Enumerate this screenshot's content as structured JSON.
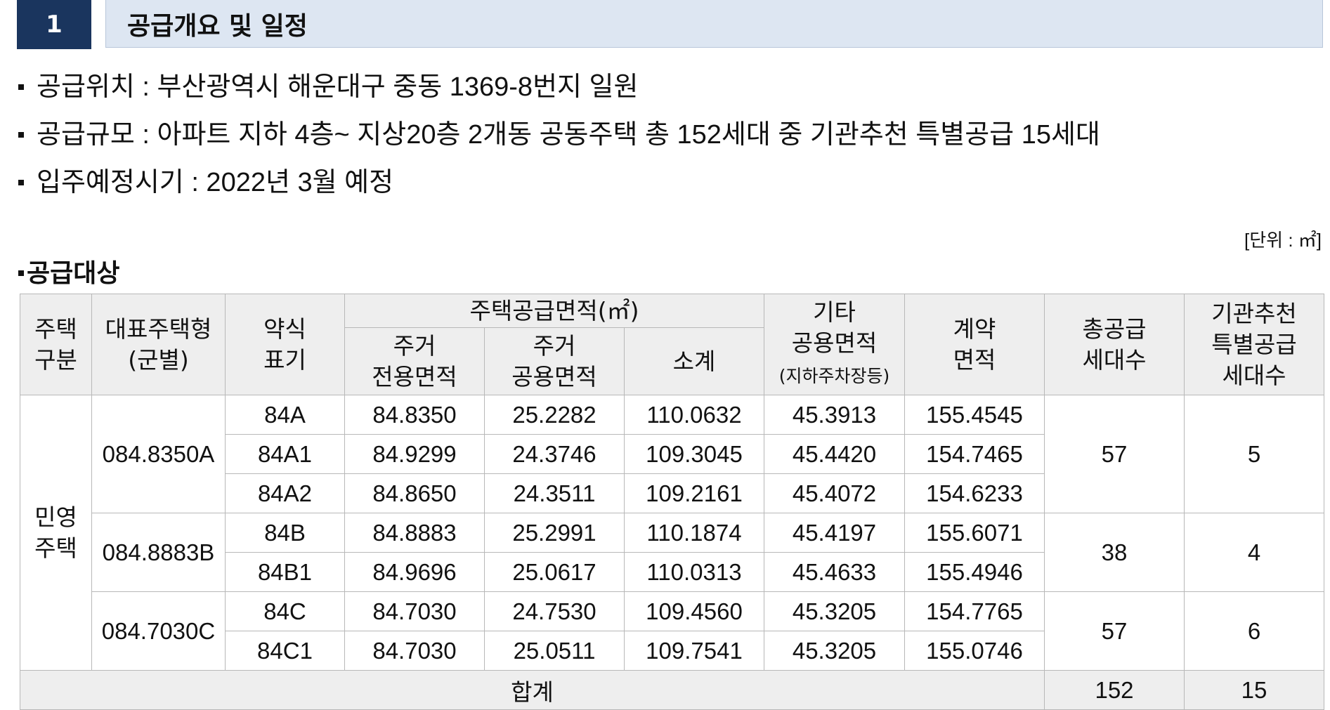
{
  "header": {
    "number": "1",
    "title": "공급개요 및 일정"
  },
  "bullets": [
    "공급위치 : 부산광역시 해운대구 중동 1369-8번지 일원",
    "공급규모 : 아파트 지하 4층~ 지상20층 2개동 공동주택 총 152세대 중 기관추천 특별공급 15세대",
    "입주예정시기 : 2022년 3월 예정"
  ],
  "unit_label": "[단위 : ㎡]",
  "section_title": "공급대상",
  "table": {
    "headers": {
      "house_type_1": "주택",
      "house_type_2": "구분",
      "rep_type_1": "대표주택형",
      "rep_type_2": "(군별)",
      "abbr_1": "약식",
      "abbr_2": "표기",
      "supply_area": "주택공급면적(㎡)",
      "res_exclusive_1": "주거",
      "res_exclusive_2": "전용면적",
      "res_common_1": "주거",
      "res_common_2": "공용면적",
      "subtotal": "소계",
      "other_common_1": "기타",
      "other_common_2": "공용면적",
      "other_common_3": "(지하주차장등)",
      "contract_1": "계약",
      "contract_2": "면적",
      "total_supply_1": "총공급",
      "total_supply_2": "세대수",
      "inst_1": "기관추천",
      "inst_2": "특별공급",
      "inst_3": "세대수"
    },
    "category_1": "민영",
    "category_2": "주택",
    "groups": [
      {
        "rep_type": "084.8350A",
        "total_supply": "57",
        "institutional": "5",
        "rows": [
          {
            "abbr": "84A",
            "exclusive": "84.8350",
            "common": "25.2282",
            "subtotal": "110.0632",
            "other": "45.3913",
            "contract": "155.4545"
          },
          {
            "abbr": "84A1",
            "exclusive": "84.9299",
            "common": "24.3746",
            "subtotal": "109.3045",
            "other": "45.4420",
            "contract": "154.7465"
          },
          {
            "abbr": "84A2",
            "exclusive": "84.8650",
            "common": "24.3511",
            "subtotal": "109.2161",
            "other": "45.4072",
            "contract": "154.6233"
          }
        ]
      },
      {
        "rep_type": "084.8883B",
        "total_supply": "38",
        "institutional": "4",
        "rows": [
          {
            "abbr": "84B",
            "exclusive": "84.8883",
            "common": "25.2991",
            "subtotal": "110.1874",
            "other": "45.4197",
            "contract": "155.6071"
          },
          {
            "abbr": "84B1",
            "exclusive": "84.9696",
            "common": "25.0617",
            "subtotal": "110.0313",
            "other": "45.4633",
            "contract": "155.4946"
          }
        ]
      },
      {
        "rep_type": "084.7030C",
        "total_supply": "57",
        "institutional": "6",
        "rows": [
          {
            "abbr": "84C",
            "exclusive": "84.7030",
            "common": "24.7530",
            "subtotal": "109.4560",
            "other": "45.3205",
            "contract": "154.7765"
          },
          {
            "abbr": "84C1",
            "exclusive": "84.7030",
            "common": "25.0511",
            "subtotal": "109.7541",
            "other": "45.3205",
            "contract": "155.0746"
          }
        ]
      }
    ],
    "total": {
      "label": "합계",
      "total_supply": "152",
      "institutional": "15"
    }
  }
}
